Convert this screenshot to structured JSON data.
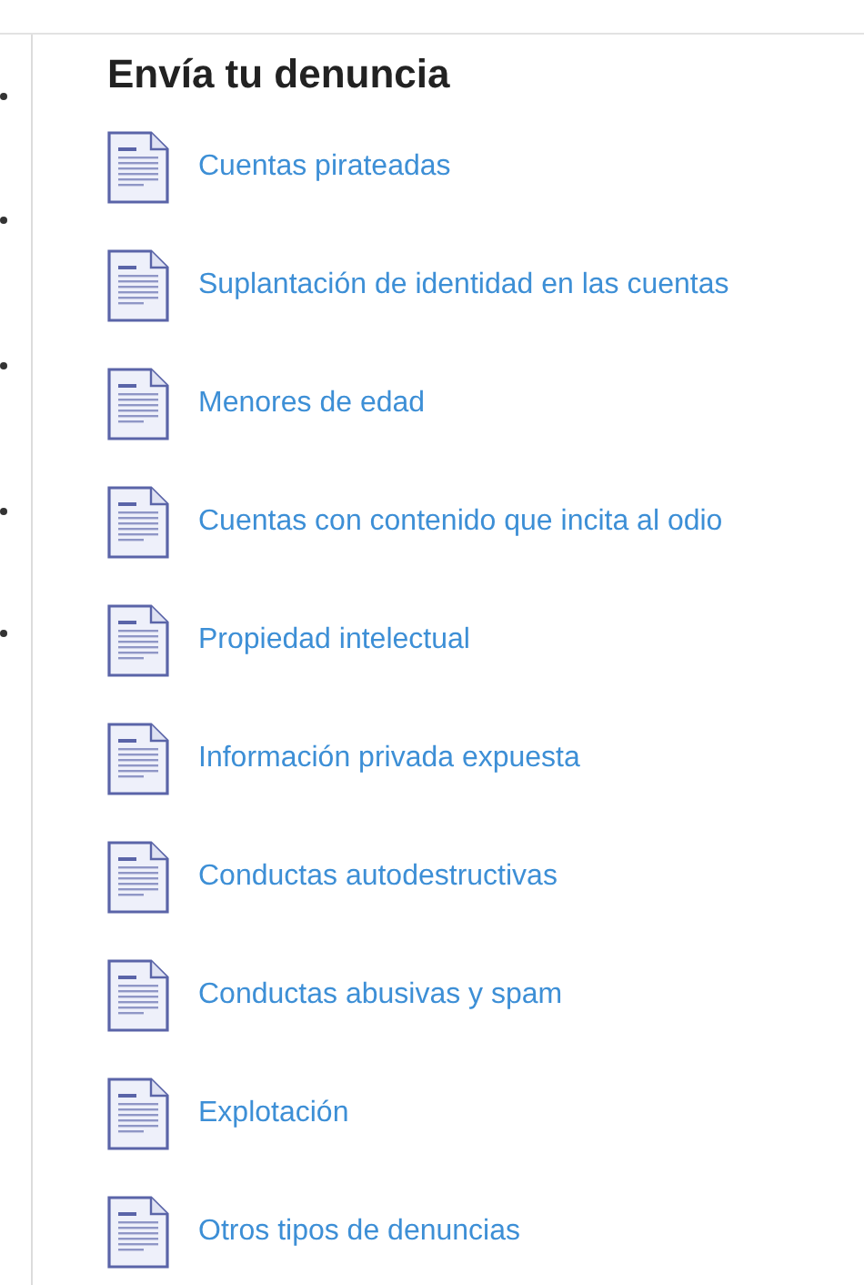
{
  "heading": "Envía tu denuncia",
  "left_bullets": [
    {
      "kind": "bullet"
    },
    {
      "kind": "bullet"
    },
    {
      "kind": "bullet"
    },
    {
      "kind": "bullet"
    },
    {
      "kind": "bullet"
    }
  ],
  "links": [
    {
      "label": "Cuentas pirateadas"
    },
    {
      "label": "Suplantación de identidad en las cuentas"
    },
    {
      "label": "Menores de edad"
    },
    {
      "label": "Cuentas con contenido que incita al odio"
    },
    {
      "label": "Propiedad intelectual"
    },
    {
      "label": "Información privada expuesta"
    },
    {
      "label": "Conductas autodestructivas"
    },
    {
      "label": "Conductas abusivas y spam"
    },
    {
      "label": "Explotación"
    },
    {
      "label": "Otros tipos de denuncias"
    }
  ]
}
